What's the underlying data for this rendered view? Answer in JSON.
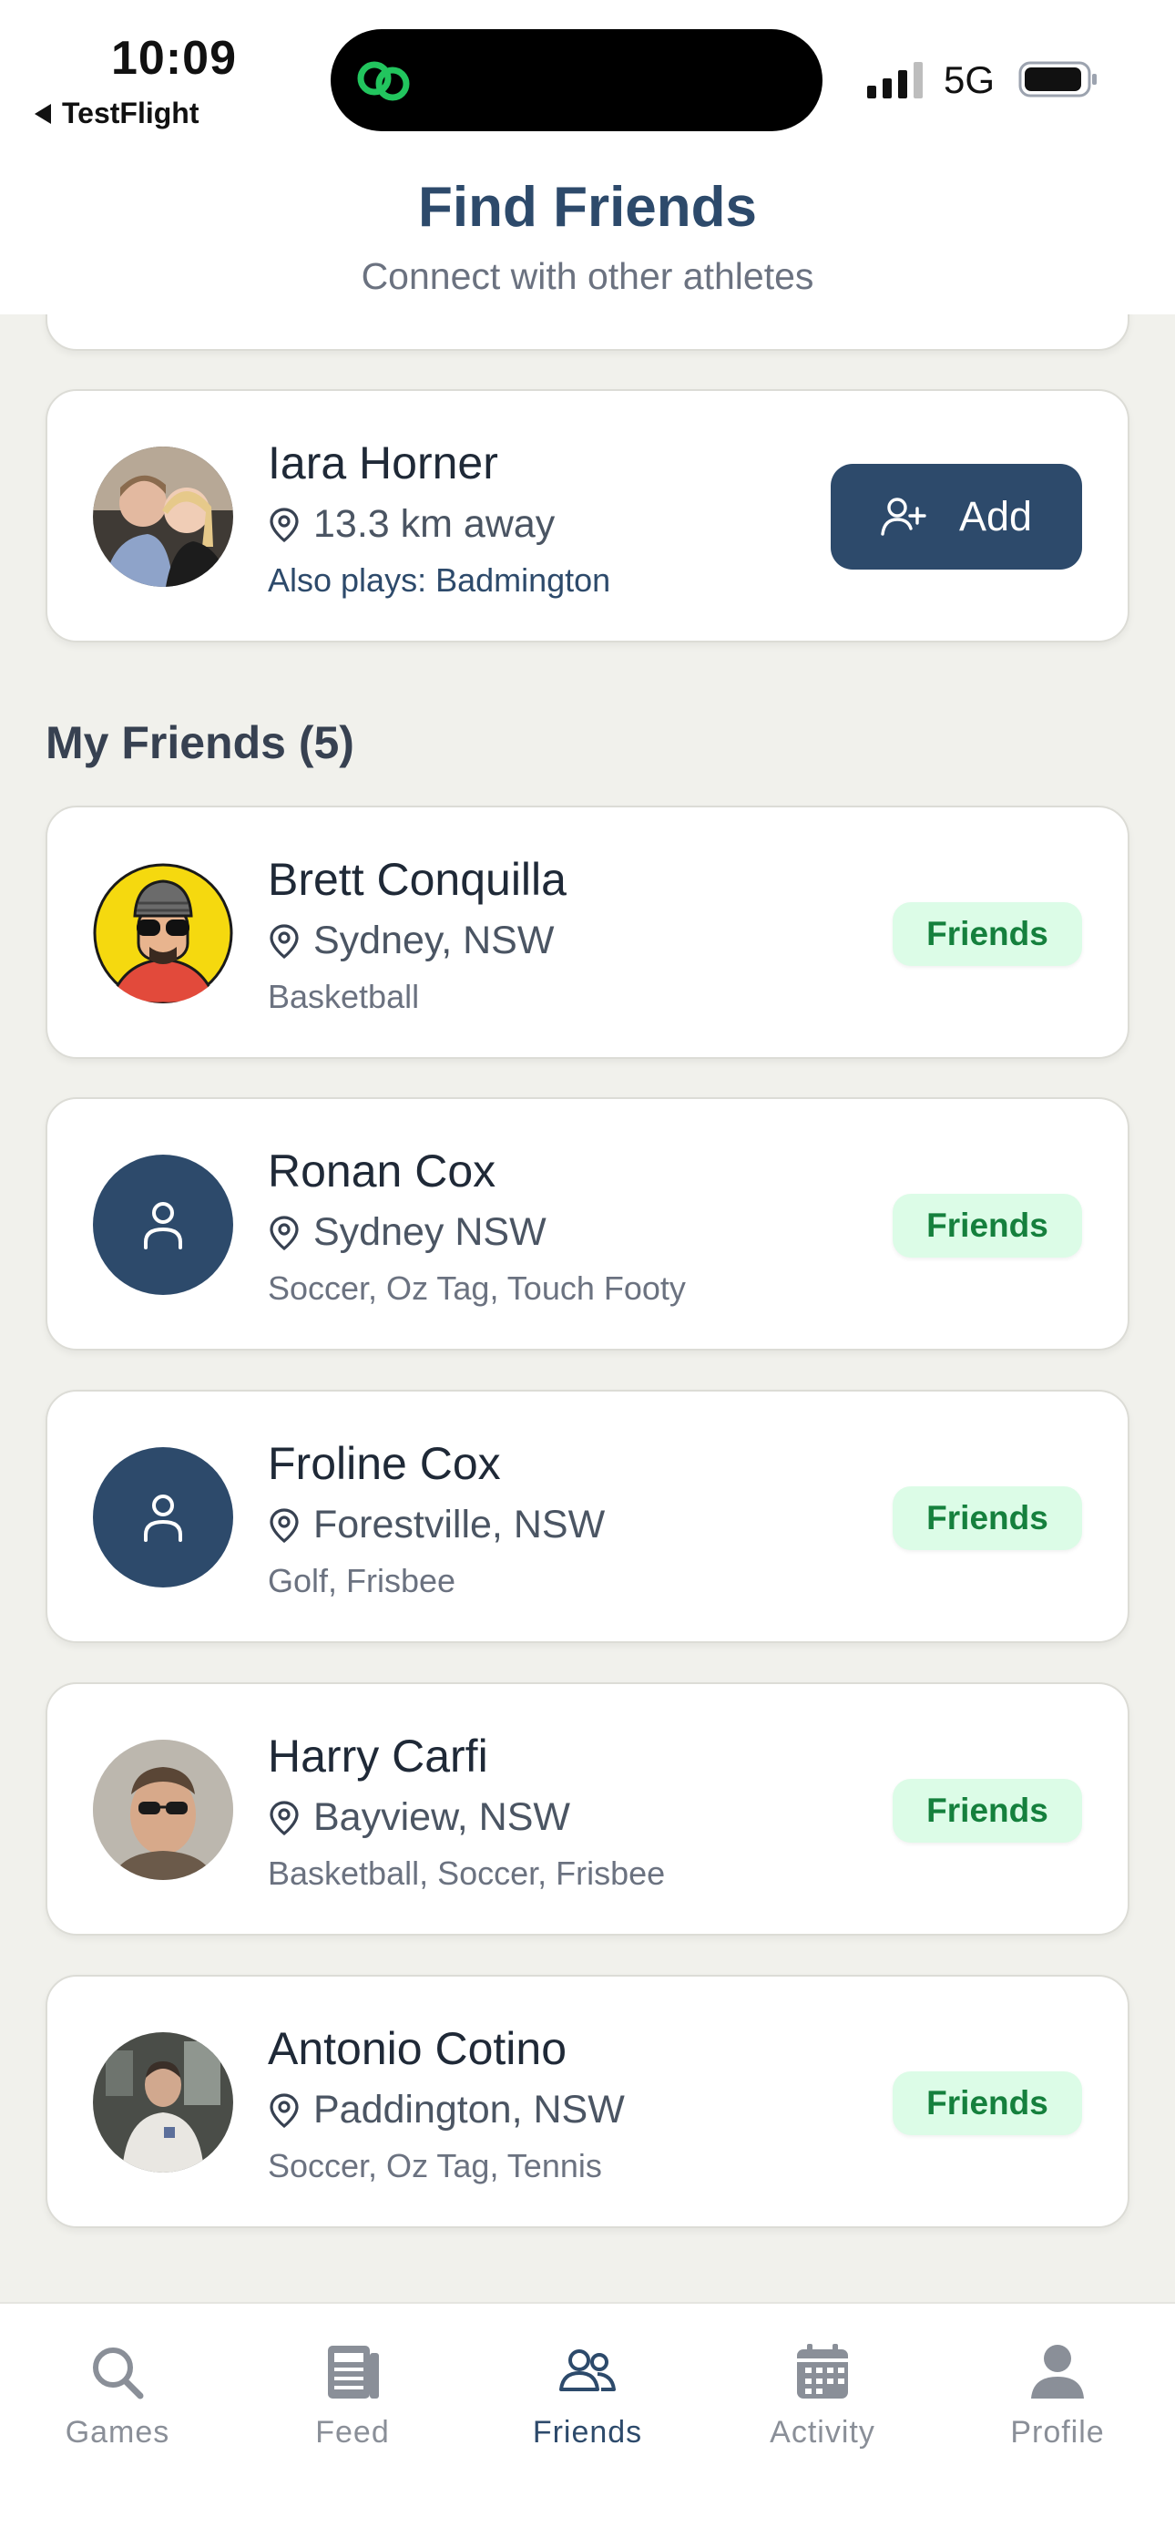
{
  "status": {
    "time": "10:09",
    "back_label": "TestFlight",
    "network": "5G"
  },
  "header": {
    "title": "Find Friends",
    "subtitle": "Connect with other athletes"
  },
  "suggestions": [
    {
      "name": "Iara Horner",
      "distance": "13.3 km away",
      "also_plays": "Also plays: Badmington",
      "action_label": "Add"
    }
  ],
  "friends_section": {
    "title": "My Friends (5)",
    "items": [
      {
        "name": "Brett Conquilla",
        "location": "Sydney, NSW",
        "sports": "Basketball",
        "status": "Friends",
        "avatar": "cartoon"
      },
      {
        "name": "Ronan Cox",
        "location": "Sydney NSW",
        "sports": "Soccer, Oz Tag, Touch Footy",
        "status": "Friends",
        "avatar": "placeholder"
      },
      {
        "name": "Froline Cox",
        "location": "Forestville, NSW",
        "sports": "Golf, Frisbee",
        "status": "Friends",
        "avatar": "placeholder"
      },
      {
        "name": "Harry Carfi",
        "location": "Bayview, NSW",
        "sports": "Basketball, Soccer, Frisbee",
        "status": "Friends",
        "avatar": "photo"
      },
      {
        "name": "Antonio Cotino",
        "location": "Paddington, NSW",
        "sports": "Soccer, Oz Tag, Tennis",
        "status": "Friends",
        "avatar": "photo"
      }
    ]
  },
  "tabs": [
    {
      "label": "Games",
      "icon": "search-icon"
    },
    {
      "label": "Feed",
      "icon": "feed-icon"
    },
    {
      "label": "Friends",
      "icon": "friends-icon",
      "active": true
    },
    {
      "label": "Activity",
      "icon": "calendar-icon"
    },
    {
      "label": "Profile",
      "icon": "person-icon"
    }
  ],
  "colors": {
    "primary": "#2d4a6b",
    "badge_bg": "#dcfce7",
    "badge_text": "#15803d",
    "background": "#f1f1ec"
  }
}
